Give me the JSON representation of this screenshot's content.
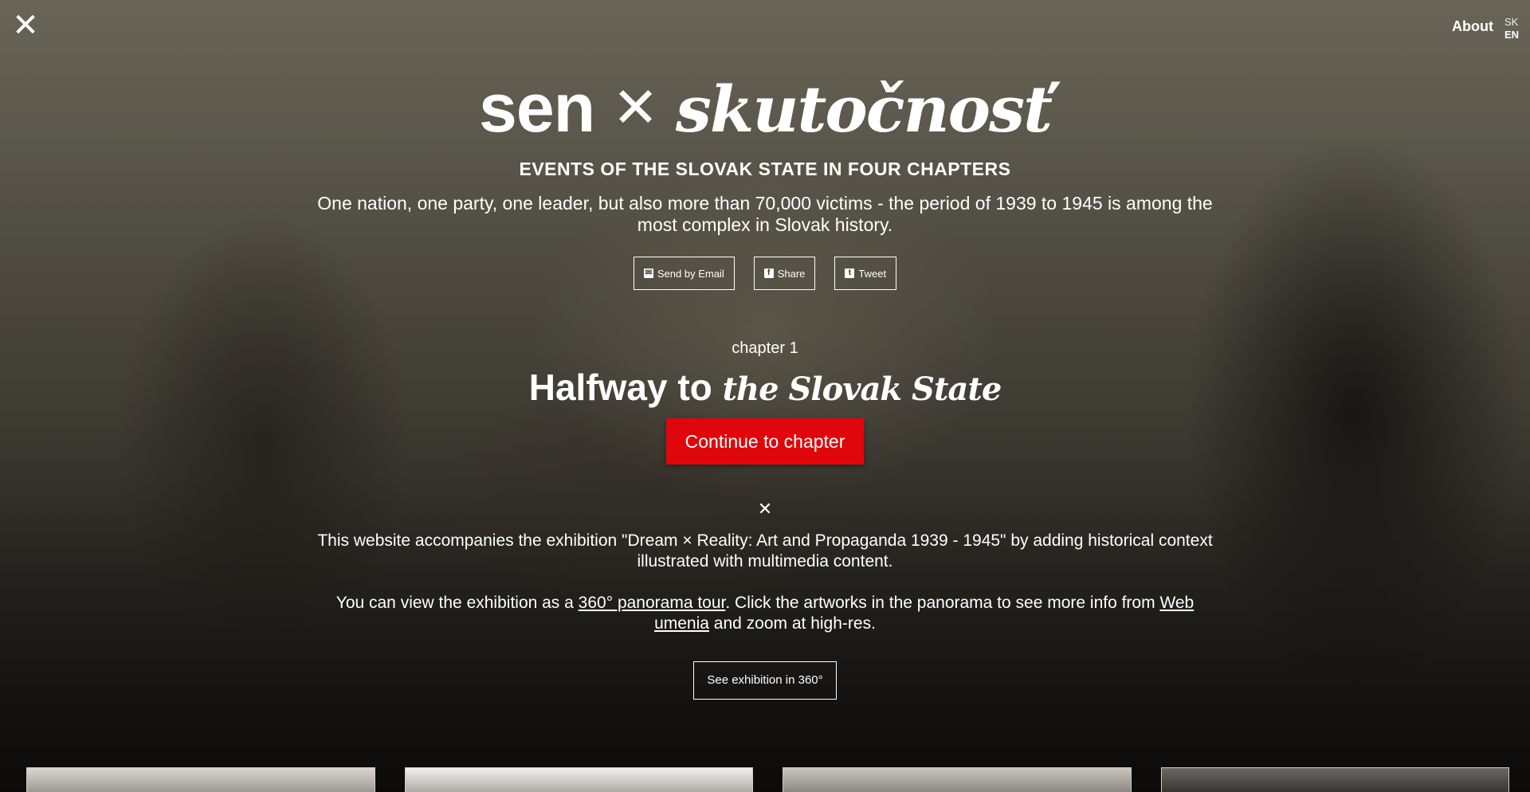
{
  "header": {
    "logo_glyph": "✕",
    "about": "About",
    "languages": [
      "SK",
      "EN"
    ],
    "active_language": "EN"
  },
  "hero": {
    "title_left": "sen",
    "title_separator": "✕",
    "title_right": "skutočnosť",
    "subtitle": "EVENTS OF THE SLOVAK STATE IN FOUR CHAPTERS",
    "lead": "One nation, one party, one leader, but also more than 70,000 victims - the period of 1939 to 1945 is among the most complex in Slovak history."
  },
  "share": {
    "email": "Send by Email",
    "facebook": "Share",
    "twitter": "Tweet",
    "icons": [
      "envelope-icon",
      "facebook-icon",
      "twitter-icon"
    ]
  },
  "chapter": {
    "label": "chapter 1",
    "title_a": "Halfway to",
    "title_b": "the Slovak State",
    "cta": "Continue to chapter"
  },
  "info": {
    "divider_glyph": "✕",
    "para1": "This website accompanies the exhibition \"Dream × Reality: Art and Propaganda 1939 - 1945\" by adding historical context illustrated with multimedia content.",
    "para2_pre": "You can view the exhibition as a ",
    "para2_link1": "360° panorama tour",
    "para2_mid": ". Click the artworks in the panorama to see more info from ",
    "para2_link2": "Web umenia",
    "para2_post": " and zoom at high-res.",
    "btn360": "See exhibition in 360°"
  },
  "colors": {
    "accent": "#e0070c",
    "text": "#ffffff"
  }
}
